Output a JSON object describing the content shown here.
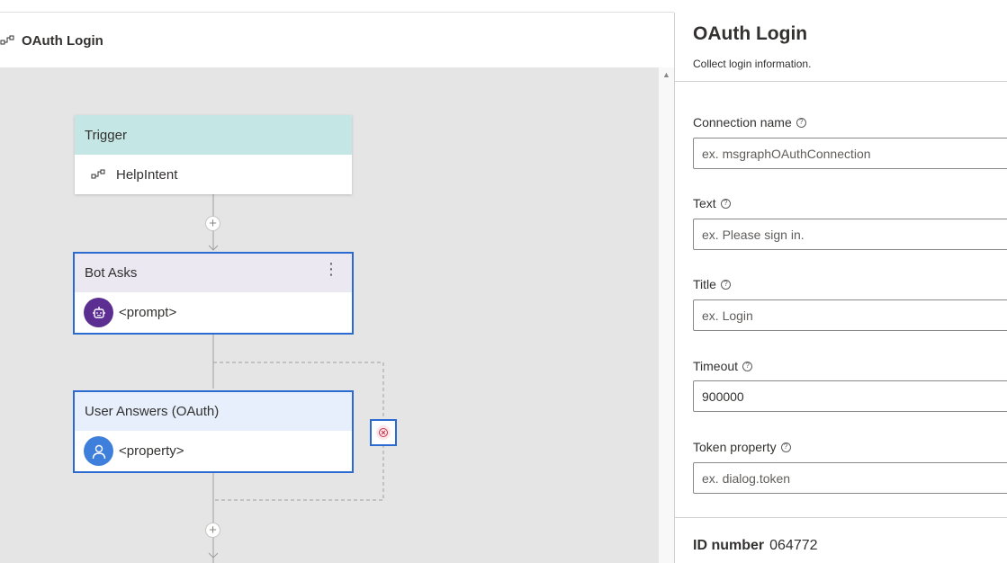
{
  "header": {
    "dialog_title": "OAuth Login",
    "icon": "dialog-flow-icon"
  },
  "canvas": {
    "trigger": {
      "title": "Trigger",
      "intent": "HelpIntent",
      "icon": "intent-icon"
    },
    "bot_asks": {
      "title": "Bot Asks",
      "value": "<prompt>",
      "icon": "bot-icon",
      "menu_glyph": "⋮"
    },
    "user_answers": {
      "title": "User Answers (OAuth)",
      "value": "<property>",
      "icon": "user-icon"
    },
    "add_glyph": "+",
    "scroll_up_glyph": "▲"
  },
  "panel": {
    "title": "OAuth Login",
    "description": "Collect login information.",
    "help_glyph": "?",
    "fields": {
      "connection_name": {
        "label": "Connection name",
        "placeholder": "ex. msgraphOAuthConnection",
        "value": ""
      },
      "text": {
        "label": "Text",
        "placeholder": "ex. Please sign in.",
        "value": ""
      },
      "title": {
        "label": "Title",
        "placeholder": "ex. Login",
        "value": ""
      },
      "timeout": {
        "label": "Timeout",
        "placeholder": "",
        "value": "900000"
      },
      "token_property": {
        "label": "Token property",
        "placeholder": "ex. dialog.token",
        "value": ""
      }
    },
    "id_label": "ID number",
    "id_value": "064772"
  },
  "colors": {
    "trigger_header": "#c4e7e5",
    "bot_asks_header": "#ebe8f2",
    "user_answers_header": "#e6effb",
    "selection_border": "#2b6bd1",
    "bot_icon_bg": "#5c2e91",
    "user_icon_bg": "#3e7fdb",
    "canvas_bg": "#e5e5e5"
  }
}
